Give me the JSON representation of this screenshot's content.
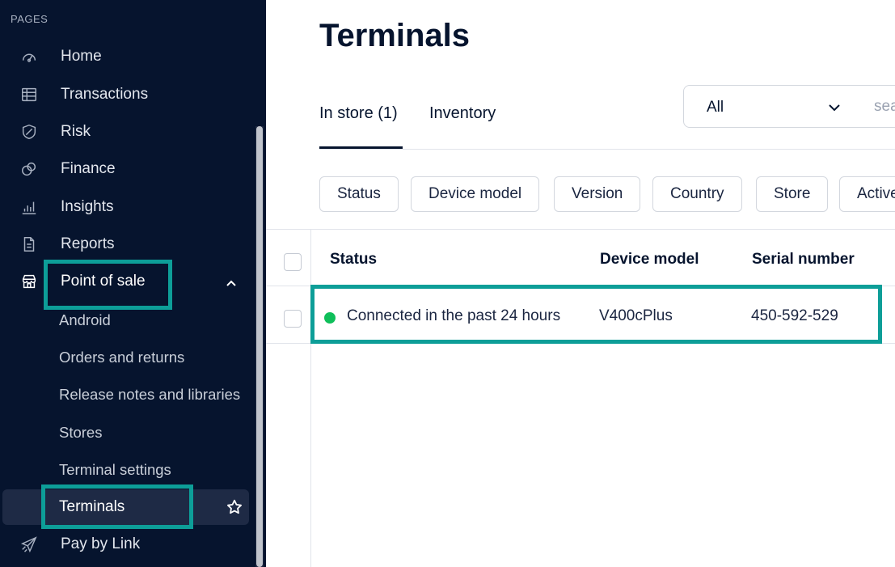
{
  "sidebar": {
    "section_label": "PAGES",
    "items": [
      {
        "label": "Home",
        "icon": "gauge-icon"
      },
      {
        "label": "Transactions",
        "icon": "table-icon"
      },
      {
        "label": "Risk",
        "icon": "shield-icon"
      },
      {
        "label": "Finance",
        "icon": "coins-icon"
      },
      {
        "label": "Insights",
        "icon": "bar-chart-icon"
      },
      {
        "label": "Reports",
        "icon": "document-icon"
      },
      {
        "label": "Point of sale",
        "icon": "store-icon"
      }
    ],
    "pos_subitems": [
      "Android",
      "Orders and returns",
      "Release notes and libraries",
      "Stores",
      "Terminal settings",
      "Terminals"
    ],
    "pay_by_link": "Pay by Link"
  },
  "main": {
    "title": "Terminals",
    "tabs": [
      {
        "label": "In store (1)"
      },
      {
        "label": "Inventory"
      }
    ],
    "select_value": "All",
    "search_placeholder": "search",
    "filters": [
      "Status",
      "Device model",
      "Version",
      "Country",
      "Store",
      "Active"
    ],
    "table": {
      "columns": [
        "Status",
        "Device model",
        "Serial number"
      ],
      "rows": [
        {
          "status": "Connected in the past 24 hours",
          "device_model": "V400cPlus",
          "serial_number": "450-592-529"
        }
      ]
    }
  },
  "colors": {
    "sidebar_bg": "#06142e",
    "highlight": "#0d9e98",
    "status_online": "#0fbf5a"
  }
}
